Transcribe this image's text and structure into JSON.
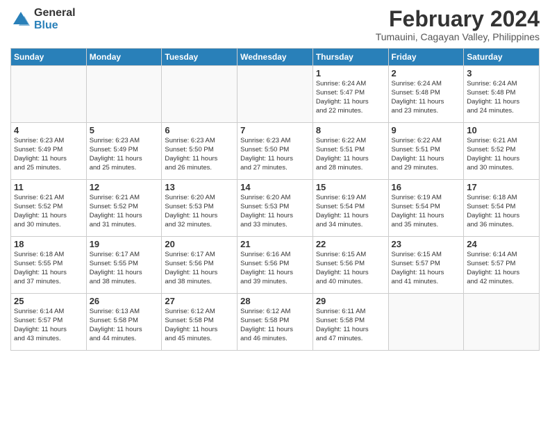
{
  "header": {
    "logo_general": "General",
    "logo_blue": "Blue",
    "month_year": "February 2024",
    "location": "Tumauini, Cagayan Valley, Philippines"
  },
  "days": [
    "Sunday",
    "Monday",
    "Tuesday",
    "Wednesday",
    "Thursday",
    "Friday",
    "Saturday"
  ],
  "weeks": [
    [
      {
        "date": "",
        "info": ""
      },
      {
        "date": "",
        "info": ""
      },
      {
        "date": "",
        "info": ""
      },
      {
        "date": "",
        "info": ""
      },
      {
        "date": "1",
        "info": "Sunrise: 6:24 AM\nSunset: 5:47 PM\nDaylight: 11 hours\nand 22 minutes."
      },
      {
        "date": "2",
        "info": "Sunrise: 6:24 AM\nSunset: 5:48 PM\nDaylight: 11 hours\nand 23 minutes."
      },
      {
        "date": "3",
        "info": "Sunrise: 6:24 AM\nSunset: 5:48 PM\nDaylight: 11 hours\nand 24 minutes."
      }
    ],
    [
      {
        "date": "4",
        "info": "Sunrise: 6:23 AM\nSunset: 5:49 PM\nDaylight: 11 hours\nand 25 minutes."
      },
      {
        "date": "5",
        "info": "Sunrise: 6:23 AM\nSunset: 5:49 PM\nDaylight: 11 hours\nand 25 minutes."
      },
      {
        "date": "6",
        "info": "Sunrise: 6:23 AM\nSunset: 5:50 PM\nDaylight: 11 hours\nand 26 minutes."
      },
      {
        "date": "7",
        "info": "Sunrise: 6:23 AM\nSunset: 5:50 PM\nDaylight: 11 hours\nand 27 minutes."
      },
      {
        "date": "8",
        "info": "Sunrise: 6:22 AM\nSunset: 5:51 PM\nDaylight: 11 hours\nand 28 minutes."
      },
      {
        "date": "9",
        "info": "Sunrise: 6:22 AM\nSunset: 5:51 PM\nDaylight: 11 hours\nand 29 minutes."
      },
      {
        "date": "10",
        "info": "Sunrise: 6:21 AM\nSunset: 5:52 PM\nDaylight: 11 hours\nand 30 minutes."
      }
    ],
    [
      {
        "date": "11",
        "info": "Sunrise: 6:21 AM\nSunset: 5:52 PM\nDaylight: 11 hours\nand 30 minutes."
      },
      {
        "date": "12",
        "info": "Sunrise: 6:21 AM\nSunset: 5:52 PM\nDaylight: 11 hours\nand 31 minutes."
      },
      {
        "date": "13",
        "info": "Sunrise: 6:20 AM\nSunset: 5:53 PM\nDaylight: 11 hours\nand 32 minutes."
      },
      {
        "date": "14",
        "info": "Sunrise: 6:20 AM\nSunset: 5:53 PM\nDaylight: 11 hours\nand 33 minutes."
      },
      {
        "date": "15",
        "info": "Sunrise: 6:19 AM\nSunset: 5:54 PM\nDaylight: 11 hours\nand 34 minutes."
      },
      {
        "date": "16",
        "info": "Sunrise: 6:19 AM\nSunset: 5:54 PM\nDaylight: 11 hours\nand 35 minutes."
      },
      {
        "date": "17",
        "info": "Sunrise: 6:18 AM\nSunset: 5:54 PM\nDaylight: 11 hours\nand 36 minutes."
      }
    ],
    [
      {
        "date": "18",
        "info": "Sunrise: 6:18 AM\nSunset: 5:55 PM\nDaylight: 11 hours\nand 37 minutes."
      },
      {
        "date": "19",
        "info": "Sunrise: 6:17 AM\nSunset: 5:55 PM\nDaylight: 11 hours\nand 38 minutes."
      },
      {
        "date": "20",
        "info": "Sunrise: 6:17 AM\nSunset: 5:56 PM\nDaylight: 11 hours\nand 38 minutes."
      },
      {
        "date": "21",
        "info": "Sunrise: 6:16 AM\nSunset: 5:56 PM\nDaylight: 11 hours\nand 39 minutes."
      },
      {
        "date": "22",
        "info": "Sunrise: 6:15 AM\nSunset: 5:56 PM\nDaylight: 11 hours\nand 40 minutes."
      },
      {
        "date": "23",
        "info": "Sunrise: 6:15 AM\nSunset: 5:57 PM\nDaylight: 11 hours\nand 41 minutes."
      },
      {
        "date": "24",
        "info": "Sunrise: 6:14 AM\nSunset: 5:57 PM\nDaylight: 11 hours\nand 42 minutes."
      }
    ],
    [
      {
        "date": "25",
        "info": "Sunrise: 6:14 AM\nSunset: 5:57 PM\nDaylight: 11 hours\nand 43 minutes."
      },
      {
        "date": "26",
        "info": "Sunrise: 6:13 AM\nSunset: 5:58 PM\nDaylight: 11 hours\nand 44 minutes."
      },
      {
        "date": "27",
        "info": "Sunrise: 6:12 AM\nSunset: 5:58 PM\nDaylight: 11 hours\nand 45 minutes."
      },
      {
        "date": "28",
        "info": "Sunrise: 6:12 AM\nSunset: 5:58 PM\nDaylight: 11 hours\nand 46 minutes."
      },
      {
        "date": "29",
        "info": "Sunrise: 6:11 AM\nSunset: 5:58 PM\nDaylight: 11 hours\nand 47 minutes."
      },
      {
        "date": "",
        "info": ""
      },
      {
        "date": "",
        "info": ""
      }
    ]
  ]
}
